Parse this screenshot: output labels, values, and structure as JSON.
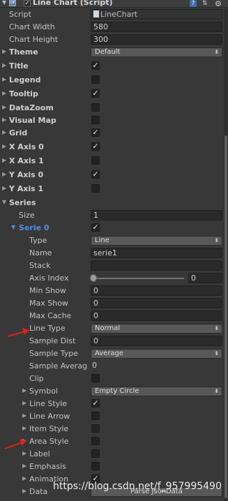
{
  "header": {
    "title": "Line Chart (Script)",
    "script_icon_text": "c#",
    "enabled": true,
    "help_icon": "question-icon",
    "preset_icon": "preset-icon",
    "gear_icon": "gear-icon"
  },
  "props": {
    "script_label": "Script",
    "script_value": "LineChart",
    "chart_width_label": "Chart Width",
    "chart_width_value": "580",
    "chart_height_label": "Chart Height",
    "chart_height_value": "300",
    "theme_label": "Theme",
    "theme_value": "Default",
    "title_label": "Title",
    "legend_label": "Legend",
    "tooltip_label": "Tooltip",
    "datazoom_label": "DataZoom",
    "visualmap_label": "Visual Map",
    "grid_label": "Grid",
    "xaxis0_label": "X Axis 0",
    "xaxis1_label": "X Axis 1",
    "yaxis0_label": "Y Axis 0",
    "yaxis1_label": "Y Axis 1",
    "series_label": "Series",
    "size_label": "Size",
    "size_value": "1",
    "serie0_label": "Serie 0"
  },
  "serie": {
    "type_label": "Type",
    "type_value": "Line",
    "name_label": "Name",
    "name_value": "serie1",
    "stack_label": "Stack",
    "stack_value": "",
    "axis_index_label": "Axis Index",
    "axis_index_value": "0",
    "min_show_label": "Min Show",
    "min_show_value": "0",
    "max_show_label": "Max Show",
    "max_show_value": "0",
    "max_cache_label": "Max Cache",
    "max_cache_value": "0",
    "line_type_label": "Line Type",
    "line_type_value": "Normal",
    "sample_dist_label": "Sample Dist",
    "sample_dist_value": "0",
    "sample_type_label": "Sample Type",
    "sample_type_value": "Average",
    "sample_average_label": "Sample Averag",
    "sample_average_value": "0",
    "clip_label": "Clip",
    "symbol_label": "Symbol",
    "symbol_value": "Empty Circle",
    "line_style_label": "Line Style",
    "line_arrow_label": "Line Arrow",
    "item_style_label": "Item Style",
    "area_style_label": "Area Style",
    "label_label": "Label",
    "emphasis_label": "Emphasis",
    "animation_label": "Animation",
    "data_label": "Data",
    "data_button": "Parse JsonData"
  },
  "watermark": "https://blog.csdn.net/f_957995490",
  "colors": {
    "panel_bg": "#383838",
    "accent_blue": "#4f8fe8",
    "annotation_red": "#e0201a"
  }
}
